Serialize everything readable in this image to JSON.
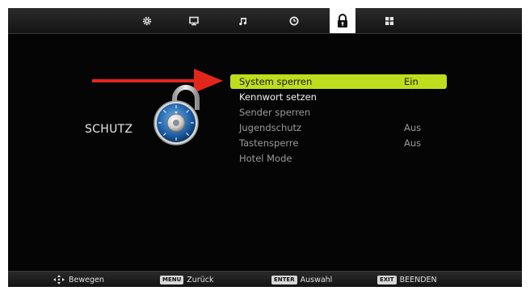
{
  "topbar": {
    "tabs": [
      {
        "icon": "gear-icon"
      },
      {
        "icon": "monitor-icon"
      },
      {
        "icon": "music-note-icon"
      },
      {
        "icon": "clock-icon"
      },
      {
        "icon": "lock-icon",
        "active": true
      },
      {
        "icon": "grid-icon"
      }
    ]
  },
  "section": {
    "title": "SCHUTZ",
    "icon": "combination-lock-icon"
  },
  "menu": {
    "items": [
      {
        "label": "System sperren",
        "value": "Ein",
        "state": "selected"
      },
      {
        "label": "Kennwort setzen",
        "value": "",
        "state": "enabled"
      },
      {
        "label": "Sender sperren",
        "value": "",
        "state": "disabled"
      },
      {
        "label": "Jugendschutz",
        "value": "Aus",
        "state": "disabled"
      },
      {
        "label": "Tastensperre",
        "value": "Aus",
        "state": "disabled"
      },
      {
        "label": "Hotel Mode",
        "value": "",
        "state": "disabled"
      }
    ]
  },
  "annotation": {
    "arrow_color": "#e3261c"
  },
  "bottombar": {
    "hints": [
      {
        "key": "",
        "icon": "dpad-icon",
        "text": "Bewegen"
      },
      {
        "key": "MENU",
        "text": "Zurück"
      },
      {
        "key": "ENTER",
        "text": "Auswahl"
      },
      {
        "key": "EXIT",
        "text": "BEENDEN"
      }
    ]
  },
  "colors": {
    "highlight": "#bede1d",
    "background": "#000000"
  }
}
